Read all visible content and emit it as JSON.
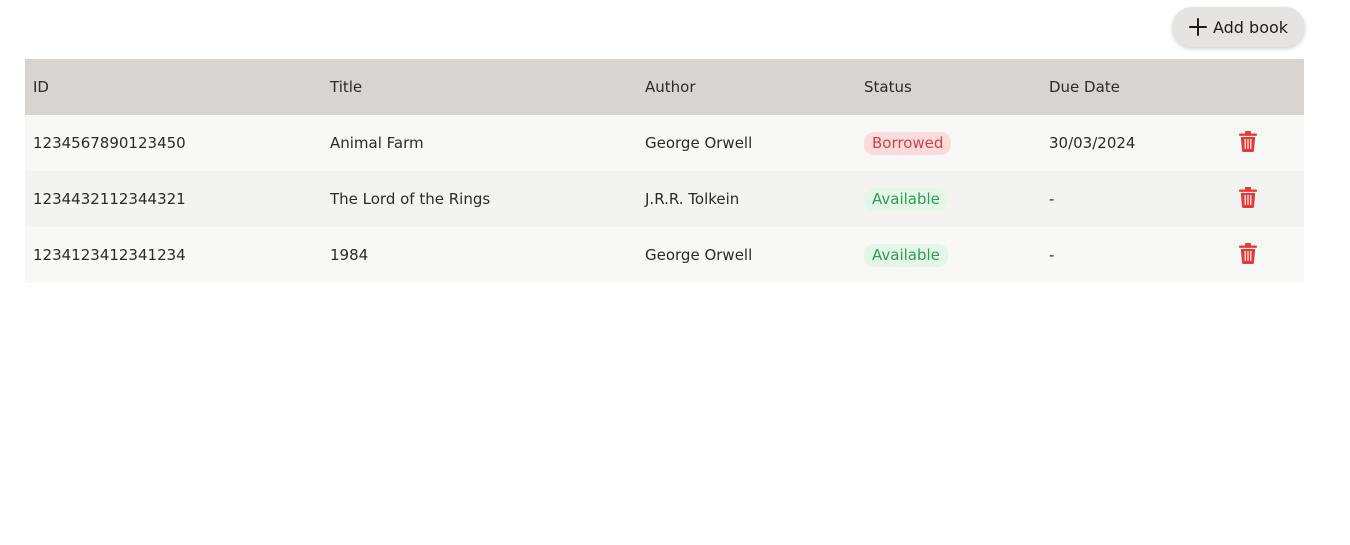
{
  "toolbar": {
    "add_label": "Add book",
    "add_icon": "plus-icon"
  },
  "table": {
    "headers": [
      "ID",
      "Title",
      "Author",
      "Status",
      "Due Date",
      ""
    ],
    "rows": [
      {
        "id": "1234567890123450",
        "title": "Animal Farm",
        "author": "George Orwell",
        "status": "Borrowed",
        "due": "30/03/2024"
      },
      {
        "id": "1234432112344321",
        "title": "The Lord of the Rings",
        "author": "J.R.R. Tolkein",
        "status": "Available",
        "due": "-"
      },
      {
        "id": "1234123412341234",
        "title": "1984",
        "author": "George Orwell",
        "status": "Available",
        "due": "-"
      }
    ]
  },
  "colors": {
    "header_bg": "#d8d4d1",
    "borrowed_bg": "#fadcdc",
    "borrowed_text": "#d14343",
    "available_bg": "#e3f6e7",
    "available_text": "#2f9e53",
    "delete_icon": "#e53935"
  }
}
